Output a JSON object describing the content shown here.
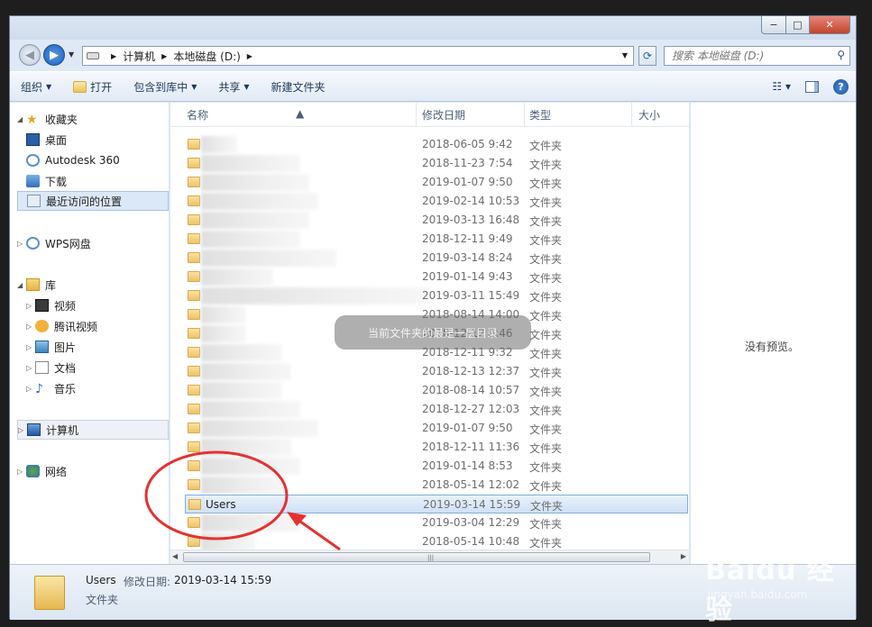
{
  "window": {
    "buttons": {
      "minimize": "−",
      "maximize": "□",
      "close": "✕"
    }
  },
  "address_bar": {
    "crumbs": [
      "计算机",
      "本地磁盘 (D:)"
    ]
  },
  "search": {
    "placeholder": "搜索 本地磁盘 (D:)"
  },
  "toolbar": {
    "organize": "组织",
    "open": "打开",
    "include_in_library": "包含到库中",
    "share": "共享",
    "new_folder": "新建文件夹"
  },
  "sidebar": {
    "favorites": "收藏夹",
    "desktop": "桌面",
    "autodesk": "Autodesk 360",
    "downloads": "下载",
    "recent": "最近访问的位置",
    "wps": "WPS网盘",
    "libraries": "库",
    "videos": "视频",
    "tencent_video": "腾讯视频",
    "pictures": "图片",
    "documents": "文档",
    "music": "音乐",
    "computer": "计算机",
    "network": "网络"
  },
  "columns": {
    "name": "名称",
    "modified": "修改日期",
    "type": "类型",
    "size": "大小"
  },
  "files": [
    {
      "date": "2018-06-05 9:42",
      "type": "文件夹"
    },
    {
      "date": "2018-11-23 7:54",
      "type": "文件夹"
    },
    {
      "date": "2019-01-07 9:50",
      "type": "文件夹"
    },
    {
      "date": "2019-02-14 10:53",
      "type": "文件夹"
    },
    {
      "date": "2019-03-13 16:48",
      "type": "文件夹"
    },
    {
      "date": "2018-12-11 9:49",
      "type": "文件夹"
    },
    {
      "date": "2019-03-14 8:24",
      "type": "文件夹"
    },
    {
      "date": "2019-01-14 9:43",
      "type": "文件夹"
    },
    {
      "date": "2019-03-11 15:49",
      "type": "文件夹"
    },
    {
      "date": "2018-08-14 14:00",
      "type": "文件夹"
    },
    {
      "date": "2018-12-12 8:46",
      "type": "文件夹"
    },
    {
      "date": "2018-12-11 9:32",
      "type": "文件夹"
    },
    {
      "date": "2018-12-13 12:37",
      "type": "文件夹"
    },
    {
      "date": "2018-08-14 10:57",
      "type": "文件夹"
    },
    {
      "date": "2018-12-27 12:03",
      "type": "文件夹"
    },
    {
      "date": "2019-01-07 9:50",
      "type": "文件夹"
    },
    {
      "date": "2018-12-11 11:36",
      "type": "文件夹"
    },
    {
      "date": "2019-01-14 8:53",
      "type": "文件夹"
    },
    {
      "date": "2018-05-14 12:02",
      "type": "文件夹"
    },
    {
      "name": "Users",
      "date": "2019-03-14 15:59",
      "type": "文件夹"
    },
    {
      "date": "2019-03-04 12:29",
      "type": "文件夹"
    },
    {
      "date": "2018-05-14 10:48",
      "type": "文件夹"
    }
  ],
  "preview": {
    "text": "没有预览。"
  },
  "toast": {
    "text": "当前文件夹的最是一层目录"
  },
  "details": {
    "name": "Users",
    "label": "修改日期:",
    "value": "2019-03-14 15:59",
    "type": "文件夹"
  },
  "watermark": {
    "logo": "Baidu 经验",
    "url": "jingyan.baidu.com"
  }
}
